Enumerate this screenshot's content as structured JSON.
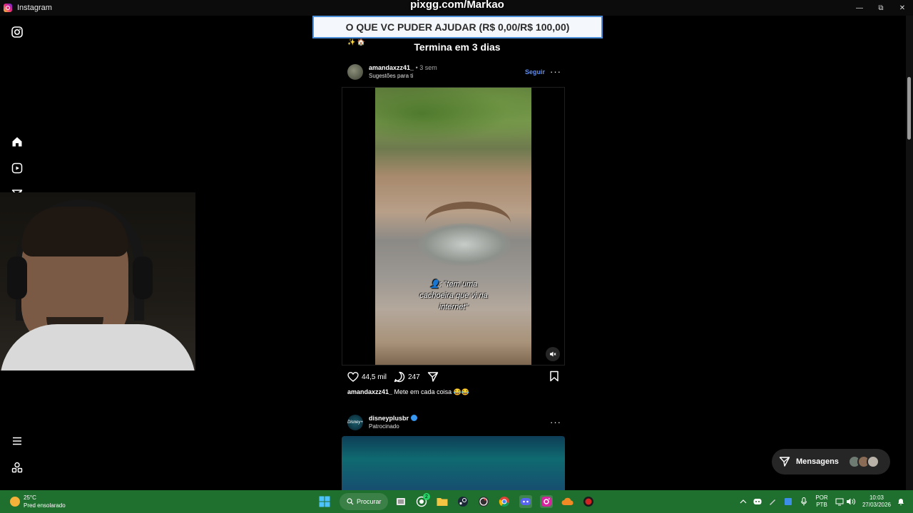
{
  "window": {
    "title": "Instagram",
    "controls": [
      "—",
      "⧉",
      "✕"
    ]
  },
  "overlay": {
    "url": "pixgg.com/Markao",
    "donation": "O QUE VC PUDER AJUDAR (R$ 0,00/R$ 100,00)",
    "goal_ends": "Termina em 3 dias",
    "sparkles": "✨ 🏠"
  },
  "nav": {
    "items": [
      {
        "name": "instagram-logo-icon"
      },
      {
        "name": "home-icon"
      },
      {
        "name": "reels-icon"
      },
      {
        "name": "direct-send-icon"
      },
      {
        "name": "search-icon"
      },
      {
        "name": "explore-icon"
      },
      {
        "name": "menu-icon"
      },
      {
        "name": "also-from-meta-icon"
      }
    ]
  },
  "post": {
    "username": "amandaxzz41_",
    "time": "• 3 sem",
    "subtitle": "Sugestões para ti",
    "follow": "Seguir",
    "more": "···",
    "video_caption": "👤: \"tem uma cachoeira que vi na internet\"",
    "likes": "44,5 mil",
    "comments": "247",
    "caption_user": "amandaxzz41_",
    "caption_text": " Mete em cada coisa 😂😂"
  },
  "ad": {
    "username": "disneyplusbr",
    "subtitle": "Patrocinado",
    "avatar_text": "Disney+",
    "more": "···"
  },
  "messages": {
    "label": "Mensagens"
  },
  "taskbar": {
    "temperature": "25°C",
    "weather": "Pred ensolarado",
    "search": "Procurar",
    "lang_top": "POR",
    "lang_bottom": "PTB",
    "time": "10:03",
    "date": "27/03/2026",
    "whatsapp_badge": "2",
    "colors": {
      "taskbar": "#1f6f2e",
      "link_blue": "#5c8df6"
    }
  }
}
